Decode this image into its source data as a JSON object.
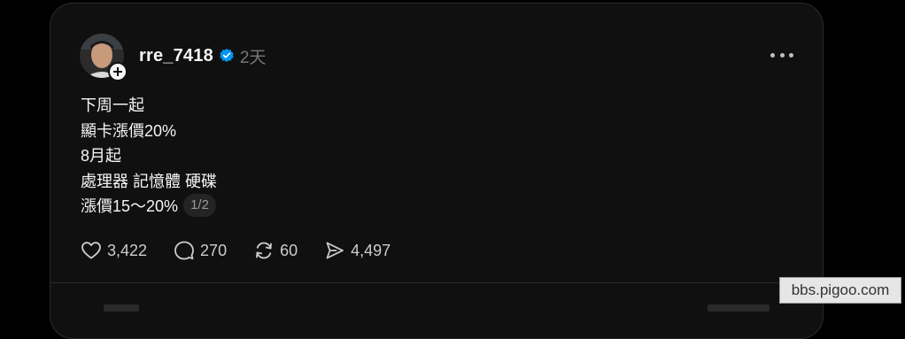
{
  "post": {
    "username": "rre_7418",
    "time": "2天",
    "lines": [
      "下周一起",
      "顯卡漲價20%",
      "8月起",
      "處理器 記憶體 硬碟",
      "漲價15～20%"
    ],
    "page_indicator": "1/2",
    "actions": {
      "likes": "3,422",
      "comments": "270",
      "reposts": "60",
      "shares": "4,497"
    }
  },
  "colors": {
    "background": "#000000",
    "card": "#101010",
    "text": "#f3f5f7",
    "muted": "#777777",
    "verified": "#0095f6"
  },
  "icons": {
    "avatar": "avatar",
    "follow": "plus-icon",
    "verified": "verified-badge-icon",
    "more": "more-dots-icon",
    "like": "heart-icon",
    "comment": "comment-icon",
    "repost": "repost-icon",
    "share": "send-icon"
  },
  "watermark": "bbs.pigoo.com"
}
